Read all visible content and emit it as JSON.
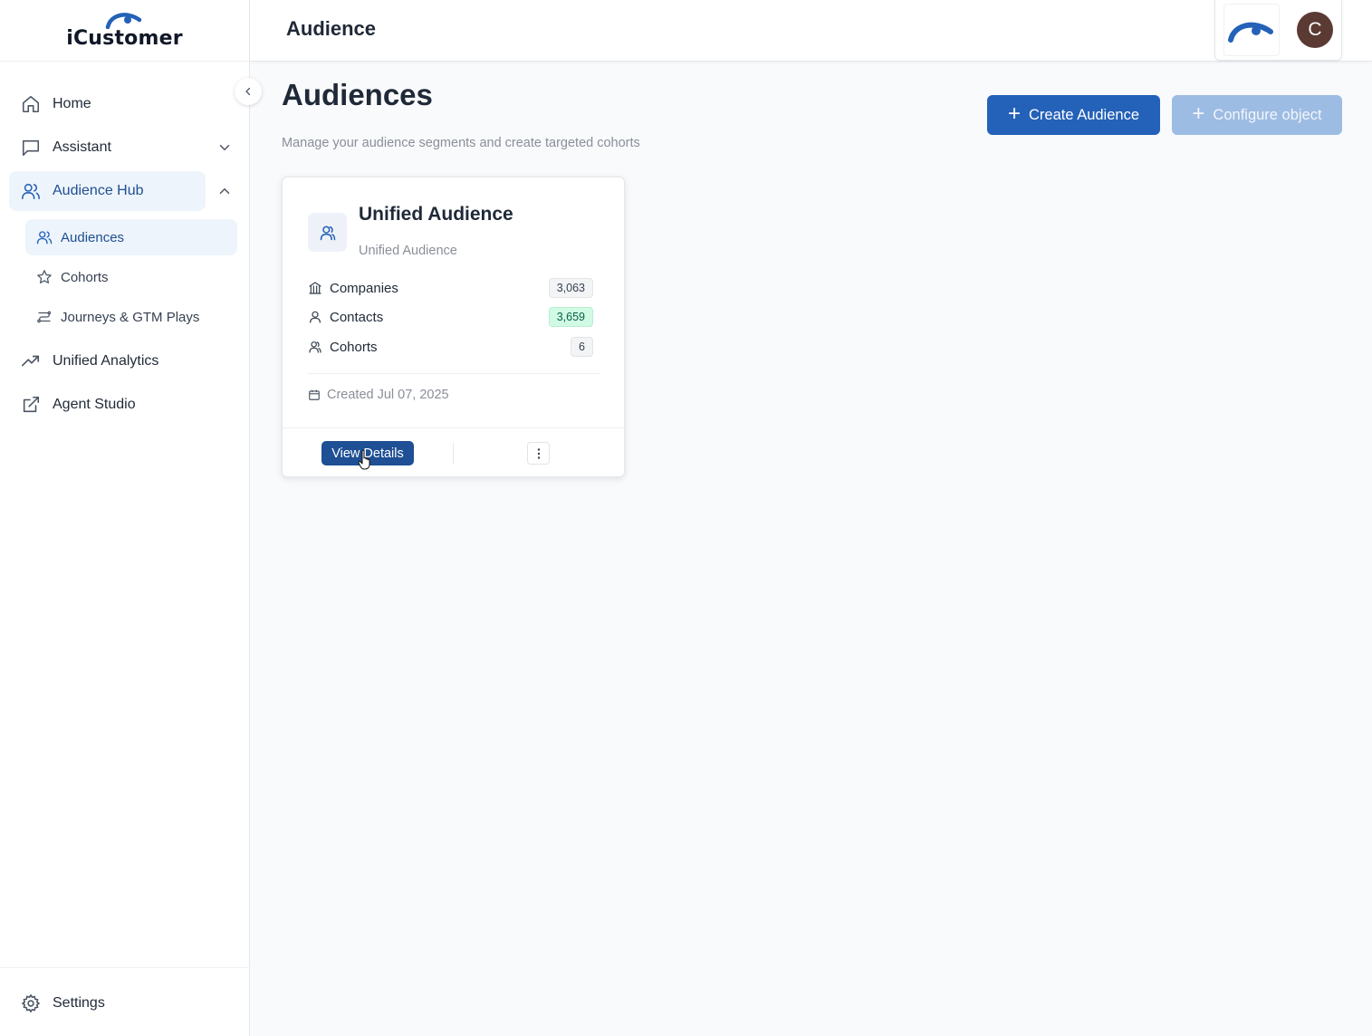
{
  "app": {
    "logo_text": "iCustomer"
  },
  "colors": {
    "primary": "#2461b8",
    "primary_disabled": "#9dbce3",
    "active_bg": "#eef4fb",
    "active_text": "#1d4f91",
    "avatar_bg": "#5b3a34",
    "contacts_badge": "#d1fae5"
  },
  "sidebar": {
    "items": [
      {
        "label": "Home",
        "icon": "home-icon"
      },
      {
        "label": "Assistant",
        "icon": "chat-icon",
        "chevron": "chevron-down-icon"
      },
      {
        "label": "Audience Hub",
        "icon": "users-icon",
        "chevron": "chevron-up-icon",
        "active": true
      },
      {
        "label": "Unified Analytics",
        "icon": "trending-up-icon"
      },
      {
        "label": "Agent Studio",
        "icon": "external-link-icon"
      }
    ],
    "sub_items": [
      {
        "label": "Audiences",
        "icon": "users-icon",
        "active": true
      },
      {
        "label": "Cohorts",
        "icon": "star-icon"
      },
      {
        "label": "Journeys & GTM Plays",
        "icon": "route-icon"
      }
    ],
    "settings_label": "Settings"
  },
  "topbar": {
    "title": "Audience",
    "avatar_initial": "C"
  },
  "main": {
    "title": "Audiences",
    "subtitle": "Manage your audience segments and create targeted cohorts",
    "create_button": "Create Audience",
    "configure_button": "Configure object"
  },
  "card": {
    "title": "Unified Audience",
    "subtitle": "Unified Audience",
    "metrics": [
      {
        "label": "Companies",
        "value": "3,063",
        "icon": "building-icon"
      },
      {
        "label": "Contacts",
        "value": "3,659",
        "icon": "user-icon"
      },
      {
        "label": "Cohorts",
        "value": "6",
        "icon": "users-icon"
      }
    ],
    "created": "Created Jul 07, 2025",
    "view_button": "View Details"
  }
}
